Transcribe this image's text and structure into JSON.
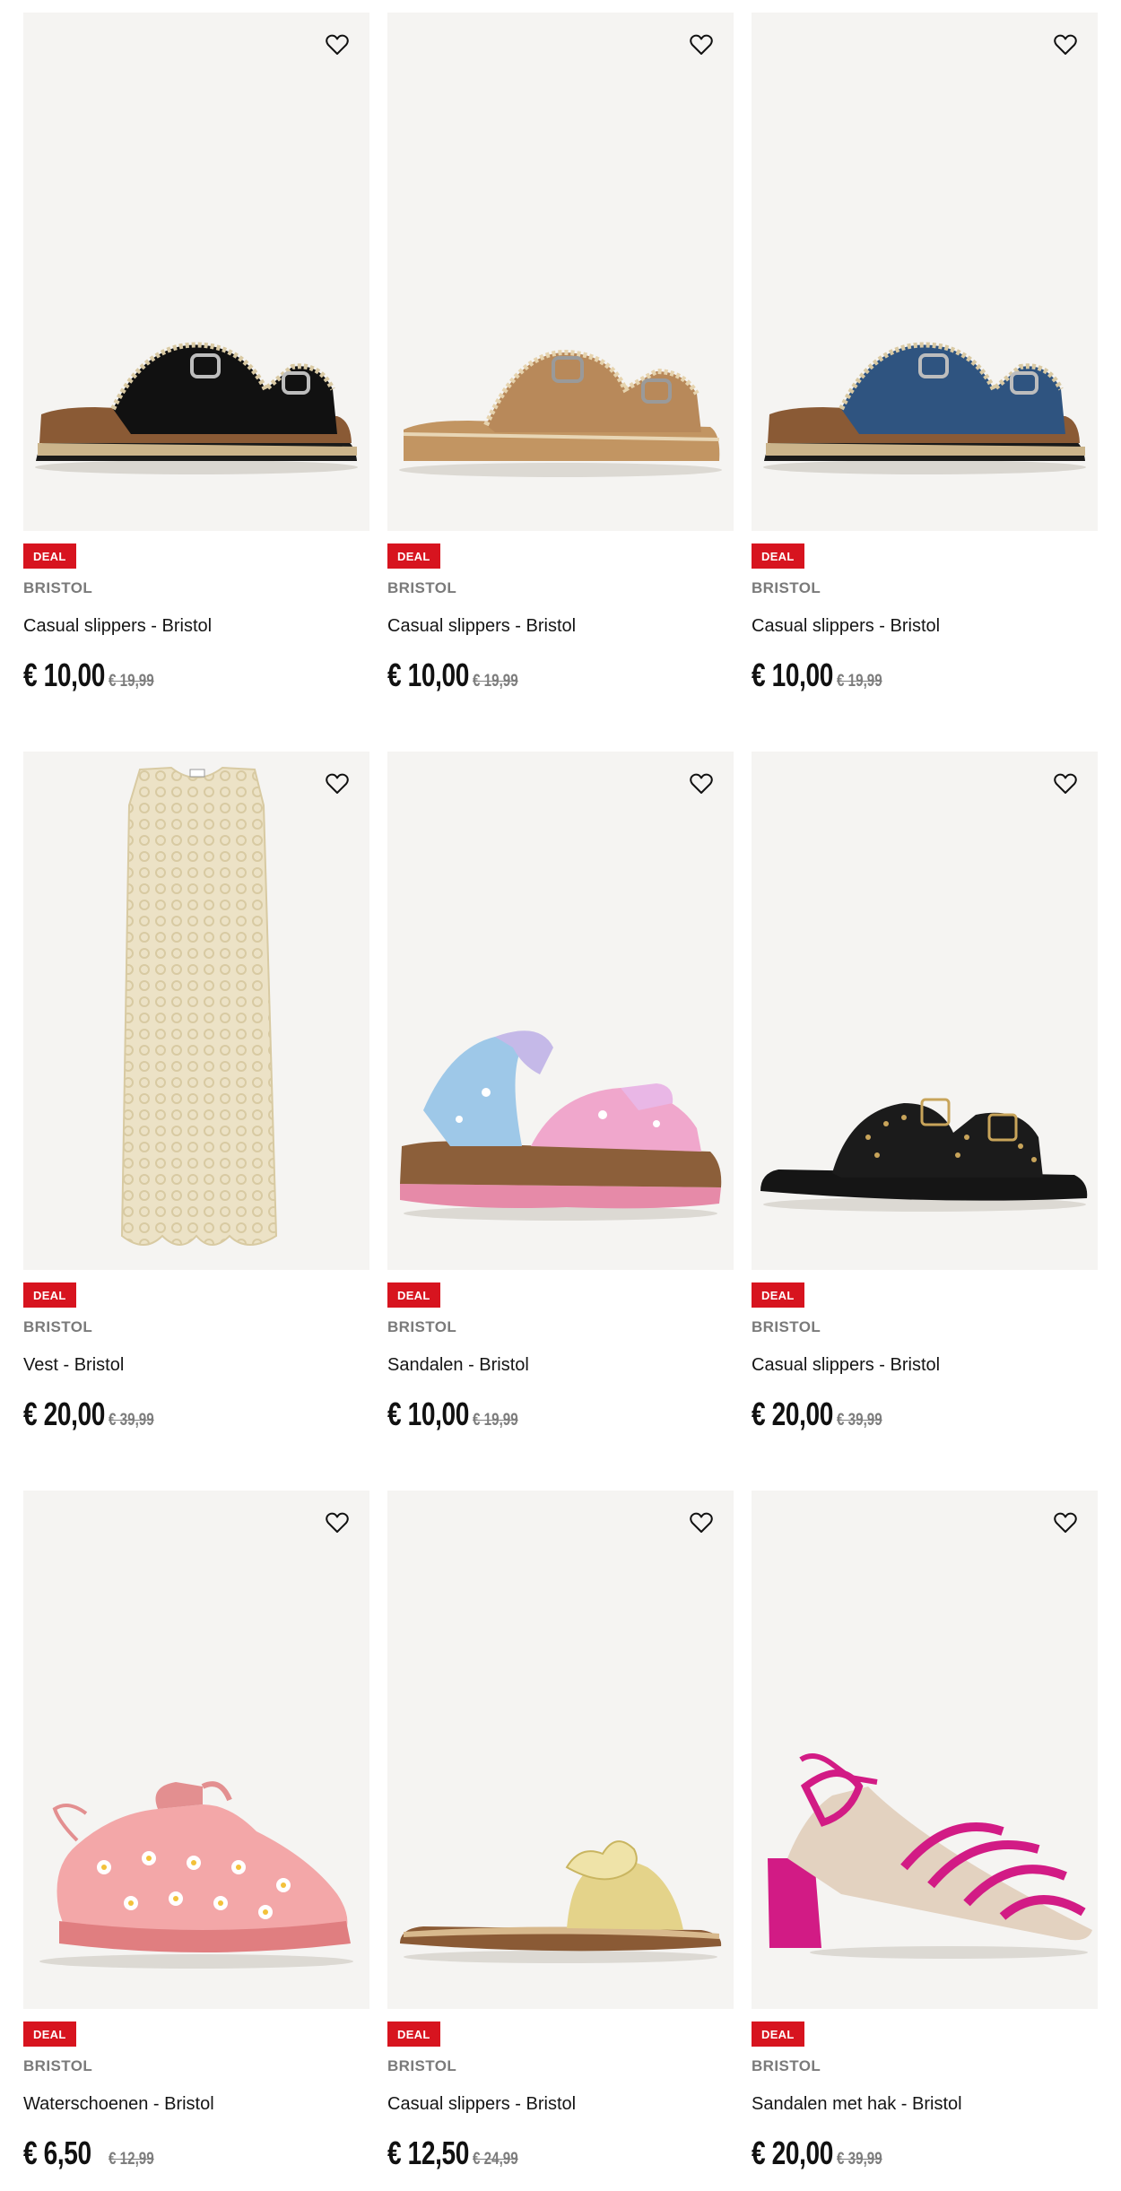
{
  "products": [
    {
      "badge": "DEAL",
      "brand": "BRISTOL",
      "title": "Casual slippers - Bristol",
      "price": "€ 10,00",
      "old_price": "€ 19,99",
      "art": "slipper-black"
    },
    {
      "badge": "DEAL",
      "brand": "BRISTOL",
      "title": "Casual slippers - Bristol",
      "price": "€ 10,00",
      "old_price": "€ 19,99",
      "art": "slipper-tan"
    },
    {
      "badge": "DEAL",
      "brand": "BRISTOL",
      "title": "Casual slippers - Bristol",
      "price": "€ 10,00",
      "old_price": "€ 19,99",
      "art": "slipper-denim"
    },
    {
      "badge": "DEAL",
      "brand": "BRISTOL",
      "title": "Vest - Bristol",
      "price": "€ 20,00",
      "old_price": "€ 39,99",
      "art": "vest"
    },
    {
      "badge": "DEAL",
      "brand": "BRISTOL",
      "title": "Sandalen - Bristol",
      "price": "€ 10,00",
      "old_price": "€ 19,99",
      "art": "sandal-glitter"
    },
    {
      "badge": "DEAL",
      "brand": "BRISTOL",
      "title": "Casual slippers - Bristol",
      "price": "€ 20,00",
      "old_price": "€ 39,99",
      "art": "slipper-studded"
    },
    {
      "badge": "DEAL",
      "brand": "BRISTOL",
      "title": "Waterschoenen - Bristol",
      "price": "€ 6,50",
      "old_price": "€ 12,99",
      "art": "water-shoe"
    },
    {
      "badge": "DEAL",
      "brand": "BRISTOL",
      "title": "Casual slippers - Bristol",
      "price": "€ 12,50",
      "old_price": "€ 24,99",
      "art": "slipper-gold"
    },
    {
      "badge": "DEAL",
      "brand": "BRISTOL",
      "title": "Sandalen met hak - Bristol",
      "price": "€ 20,00",
      "old_price": "€ 39,99",
      "art": "heel-pink"
    }
  ],
  "colors": {
    "deal_badge": "#d7141f",
    "image_bg": "#f5f4f2",
    "brand_text": "#7a7a7a"
  },
  "icons": {
    "wishlist": "heart-outline-icon"
  }
}
